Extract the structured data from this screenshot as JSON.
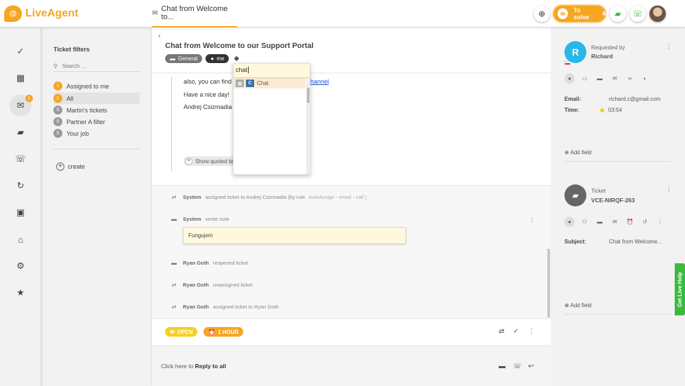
{
  "app": {
    "logo_letter": "@",
    "logo_text": "LiveAgent"
  },
  "top_tab": {
    "label": "Chat from Welcome to...",
    "icon": "envelope-icon"
  },
  "to_solve": {
    "label": "To solve",
    "count": "4"
  },
  "nav": {
    "items": [
      {
        "name": "dashboard-check-icon",
        "glyph": "✓"
      },
      {
        "name": "reports-grid-icon",
        "glyph": "▦"
      },
      {
        "name": "tickets-mail-icon",
        "glyph": "✉",
        "badge": "1"
      },
      {
        "name": "chat-icon",
        "glyph": "▰"
      },
      {
        "name": "call-phone-icon",
        "glyph": "☏"
      },
      {
        "name": "reports-refresh-icon",
        "glyph": "↻"
      },
      {
        "name": "contacts-icon",
        "glyph": "▣"
      },
      {
        "name": "knowledge-bank-icon",
        "glyph": "⌂"
      },
      {
        "name": "settings-gear-icon",
        "glyph": "⚙"
      },
      {
        "name": "plugins-star-icon",
        "glyph": "★"
      }
    ]
  },
  "filters": {
    "title": "Ticket filters",
    "search_placeholder": "Search ...",
    "items": [
      {
        "count": "1",
        "label": "Assigned to me"
      },
      {
        "count": "1",
        "label": "All"
      },
      {
        "count": "0",
        "label": "Martin's tickets"
      },
      {
        "count": "0",
        "label": "Partner A filter"
      },
      {
        "count": "0",
        "label": "Your job"
      }
    ],
    "create_label": "create"
  },
  "ticket": {
    "back": "‹",
    "title": "Chat from Welcome to our Support Portal",
    "tags": [
      "General",
      "me"
    ],
    "message_lines": {
      "line1": "also, you can find m",
      "line1_link": "be channel",
      "line2": "Have a nice day!",
      "line3": "Andrej Csizmadia"
    },
    "show_quoted": "Show quoted te"
  },
  "dropdown": {
    "input_value": "chat",
    "item_prefix": "C",
    "item_label": "Chat"
  },
  "activity": {
    "rows": [
      {
        "who": "System",
        "text": "assigned ticket to Andrej Csizmadia (by rule:",
        "rule": "AutoAssign - email - call )"
      },
      {
        "who": "System",
        "text": "wrote note",
        "rule": ""
      },
      {
        "who": "Ryan Goth",
        "text": "reopened ticket",
        "rule": ""
      },
      {
        "who": "Ryan Goth",
        "text": "unassigned ticket",
        "rule": ""
      },
      {
        "who": "Ryan Goth",
        "text": "assigned ticket to Ryan Goth",
        "rule": ""
      }
    ],
    "note_text": "Fungujem"
  },
  "status": {
    "open_label": "OPEN",
    "hour_label": "1 HOUR"
  },
  "reply": {
    "prefix": "Click here to",
    "action": "Reply to all"
  },
  "requester": {
    "avatar_letter": "R",
    "label": "Requested by",
    "name": "Richard",
    "email_label": "Email:",
    "email_value": "richard.c@gmail.com",
    "time_label": "Time:",
    "time_value": "03:54",
    "add_field": "Add field"
  },
  "ticket_info": {
    "label": "Ticket",
    "code": "VCE-NIRQF-263",
    "subject_label": "Subject:",
    "subject_value": "Chat from Welcome...",
    "add_field": "Add field"
  },
  "live_help": "Get Live Help",
  "colors": {
    "accent": "#f5a623",
    "open": "#f5d020",
    "avatar": "#29b6e8",
    "help": "#3cba3c"
  }
}
